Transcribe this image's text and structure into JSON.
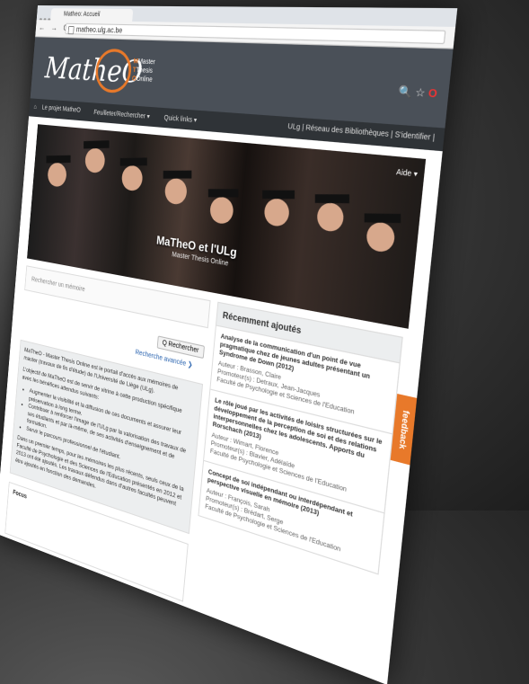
{
  "browser": {
    "tab_title": "Matheo: Accueil",
    "url": "matheo.ulg.ac.be",
    "nav": "← → C"
  },
  "header": {
    "logo": "MatheO",
    "logo_sub": [
      "Master",
      "Thesis",
      "Online"
    ],
    "links": "ULg | Réseau des Bibliothèques | S'identifier |"
  },
  "navbar": {
    "items": [
      "Le projet MatheO",
      "Feuilleter/Rechercher ▾",
      "Quick links ▾"
    ],
    "right": "Aide ▾"
  },
  "banner": {
    "title": "MaTheO et l'ULg",
    "subtitle": "Master Thesis Online"
  },
  "search": {
    "placeholder": "Rechercher un mémoire",
    "button": "Q Rechercher",
    "advanced": "Recherche avancée ❯"
  },
  "intro": {
    "p1": "MaTheO - Master Thesis Online est le portail d'accès aux mémoires de master (travaux de fin d'étude) de l'Université de Liège (ULg).",
    "p2": "L'objectif de MaTheO est de servir de vitrine à cette production spécifique avec les bénéfices attendus suivants:",
    "bullets": [
      "Augmenter la visibilité et la diffusion de ces documents et assurer leur préservation à long terme.",
      "Contribuer à renforcer l'image de l'ULg par la valorisation des travaux de ses étudiants et par là-même, de ses activités d'enseignement et de formation.",
      "Servir le parcours professionnel de l'étudiant."
    ],
    "p3": "Dans un premier temps, pour les mémoires les plus récents, seuls ceux de la Faculté de Psychologie et des Sciences de l'Education présentés en 2012 et 2013 ont été ajoutés. Les travaux défendus dans d'autres facultés peuvent être ajoutés en fonction des demandes."
  },
  "focus": {
    "label": "Focus"
  },
  "recent": {
    "title": "Récemment ajoutés",
    "entries": [
      {
        "title": "Analyse de la communication d'un point de vue pragmatique chez de jeunes adultes présentant un Syndrome de Down (2012)",
        "author": "Auteur : Brasson, Claire",
        "promoter": "Promoteur(s) : Detraux, Jean-Jacques",
        "faculty": "Faculté de Psychologie et Sciences de l'Education"
      },
      {
        "title": "Le rôle joué par les activités de loisirs structurées sur le développement de la perception de soi et des relations interpersonnelles chez les adolescents. Apports du Rorschach (2013)",
        "author": "Auteur : Wimart, Florence",
        "promoter": "Promoteur(s) : Blavier, Adélaïde",
        "faculty": "Faculté de Psychologie et Sciences de l'Education"
      },
      {
        "title": "Concept de soi indépendant ou interdépendant et perspective visuelle en mémoire (2013)",
        "author": "Auteur : François, Sarah",
        "promoter": "Promoteur(s) : Brédart, Serge",
        "faculty": "Faculté de Psychologie et Sciences de l'Education"
      }
    ]
  },
  "feedback": "feedback"
}
